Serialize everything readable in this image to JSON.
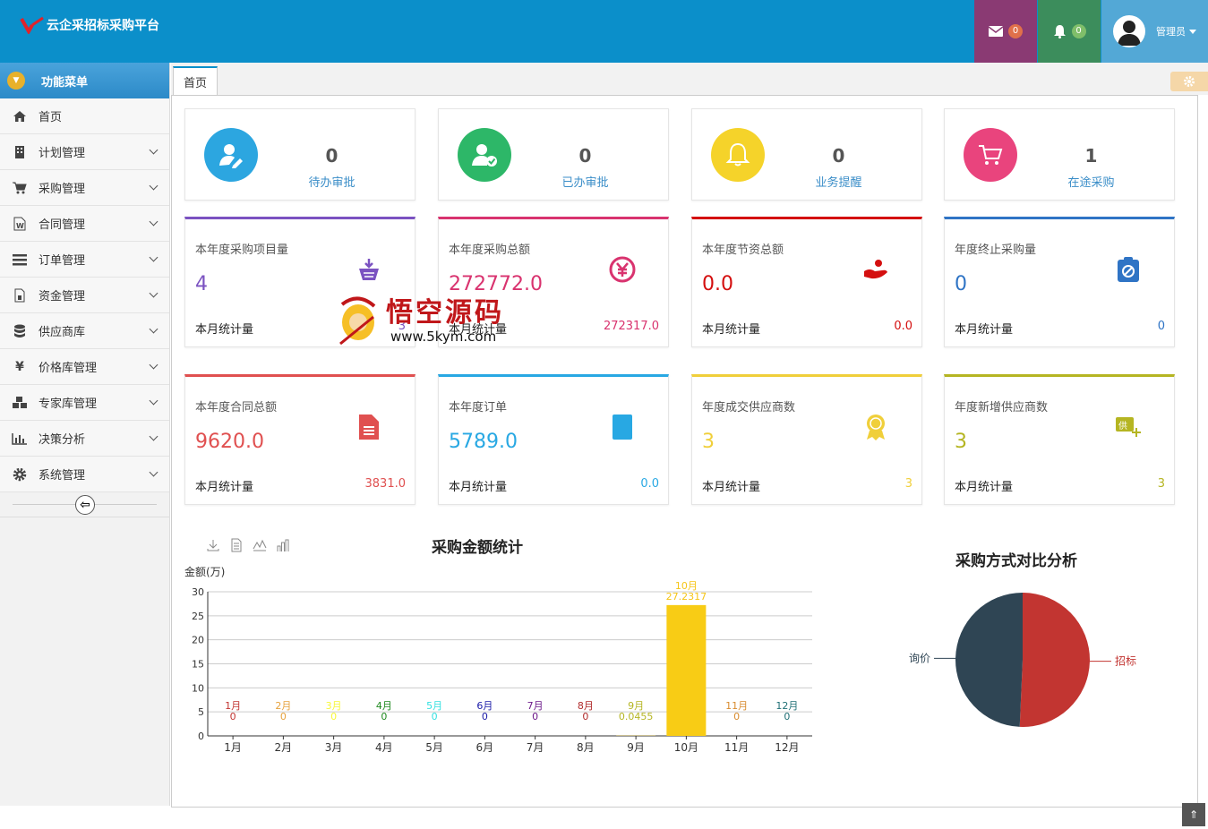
{
  "app": {
    "title": "云企采招标采购平台"
  },
  "topbar": {
    "msg_count": "0",
    "bell_count": "0",
    "user_name": "管理员"
  },
  "sidebar": {
    "header": "功能菜单",
    "items": [
      {
        "label": "首页",
        "icon": "home-icon"
      },
      {
        "label": "计划管理",
        "icon": "building-icon"
      },
      {
        "label": "采购管理",
        "icon": "cart-icon"
      },
      {
        "label": "合同管理",
        "icon": "word-doc-icon"
      },
      {
        "label": "订单管理",
        "icon": "list-icon"
      },
      {
        "label": "资金管理",
        "icon": "document-icon"
      },
      {
        "label": "供应商库",
        "icon": "database-icon"
      },
      {
        "label": "价格库管理",
        "icon": "yen-icon"
      },
      {
        "label": "专家库管理",
        "icon": "cubes-icon"
      },
      {
        "label": "决策分析",
        "icon": "bar-chart-icon"
      },
      {
        "label": "系统管理",
        "icon": "gear-icon"
      }
    ]
  },
  "tabs": {
    "home": "首页"
  },
  "summary": [
    {
      "value": "0",
      "label": "待办审批",
      "color": "#2ca6e0",
      "icon": "user-edit-icon"
    },
    {
      "value": "0",
      "label": "已办审批",
      "color": "#2db768",
      "icon": "user-check-icon"
    },
    {
      "value": "0",
      "label": "业务提醒",
      "color": "#f5d32a",
      "icon": "bell-icon"
    },
    {
      "value": "1",
      "label": "在途采购",
      "color": "#e9447d",
      "icon": "cart-icon"
    }
  ],
  "stats": [
    {
      "title": "本年度采购项目量",
      "value": "4",
      "foot": "本月统计量",
      "month": "3",
      "color": "#7b52c1"
    },
    {
      "title": "本年度采购总额",
      "value": "272772.0",
      "foot": "本月统计量",
      "month": "272317.0",
      "color": "#d9336f"
    },
    {
      "title": "本年度节资总额",
      "value": "0.0",
      "foot": "本月统计量",
      "month": "0.0",
      "color": "#d40f0f"
    },
    {
      "title": "年度终止采购量",
      "value": "0",
      "foot": "本月统计量",
      "month": "0",
      "color": "#2f74c5"
    },
    {
      "title": "本年度合同总额",
      "value": "9620.0",
      "foot": "本月统计量",
      "month": "3831.0",
      "color": "#e05050"
    },
    {
      "title": "本年度订单",
      "value": "5789.0",
      "foot": "本月统计量",
      "month": "0.0",
      "color": "#28a8e3"
    },
    {
      "title": "年度成交供应商数",
      "value": "3",
      "foot": "本月统计量",
      "month": "3",
      "color": "#f0cf3a"
    },
    {
      "title": "年度新增供应商数",
      "value": "3",
      "foot": "本月统计量",
      "month": "3",
      "color": "#b5b522"
    }
  ],
  "chart_data": [
    {
      "type": "bar",
      "title": "采购金额统计",
      "ylabel": "金额(万)",
      "categories": [
        "1月",
        "2月",
        "3月",
        "4月",
        "5月",
        "6月",
        "7月",
        "8月",
        "9月",
        "10月",
        "11月",
        "12月"
      ],
      "values": [
        0,
        0,
        0,
        0,
        0,
        0,
        0,
        0,
        0.0455,
        27.2317,
        0,
        0
      ],
      "value_labels": [
        "0",
        "0",
        "0",
        "0",
        "0",
        "0",
        "0",
        "0",
        "0.0455",
        "27.2317",
        "0",
        "0"
      ],
      "label_colors": [
        "#c23531",
        "#e6a23c",
        "#f7f73a",
        "#1f8a1f",
        "#33e0e0",
        "#1a1aa8",
        "#6d1a8a",
        "#b02a2a",
        "#b5b522",
        "#f5c518",
        "#d88b2e",
        "#1f6f75"
      ],
      "bar_color": "#f8cc15",
      "ylim": [
        0,
        30
      ],
      "yticks": [
        0,
        5,
        10,
        15,
        20,
        25,
        30
      ],
      "grid": true
    },
    {
      "type": "pie",
      "title": "采购方式对比分析",
      "labels": [
        "招标",
        "询价"
      ],
      "values": [
        50.7,
        49.3
      ],
      "colors": [
        "#c23531",
        "#2f4554"
      ]
    }
  ],
  "watermark": {
    "text": "悟空源码",
    "url": "www.5kym.com"
  }
}
